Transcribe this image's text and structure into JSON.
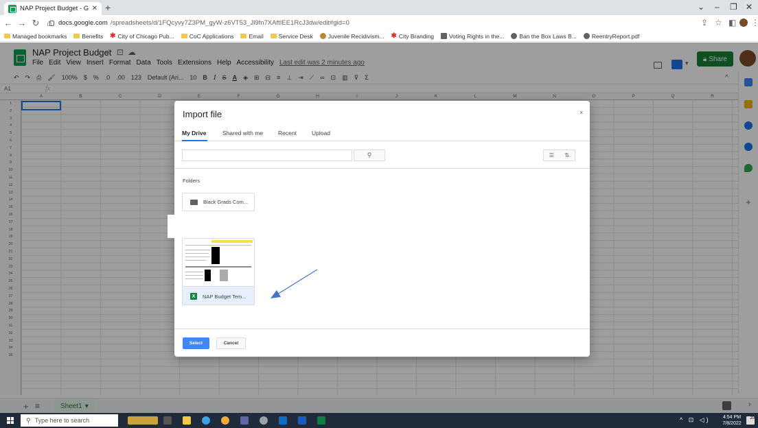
{
  "browser": {
    "tab_title": "NAP Project Budget - Google Sh",
    "url_host": "docs.google.com",
    "url_path": "/spreadsheets/d/1FQcyvy7Z3PM_gyW-z6VT53_Jl9fn7XAftIEE1RcJ3dw/edit#gid=0",
    "bookmarks": [
      {
        "icon": "folder",
        "label": "Managed bookmarks"
      },
      {
        "icon": "folder",
        "label": "Benefits"
      },
      {
        "icon": "star",
        "label": "City of Chicago Pub..."
      },
      {
        "icon": "folder",
        "label": "CoC Applications"
      },
      {
        "icon": "folder",
        "label": "Email"
      },
      {
        "icon": "folder",
        "label": "Service Desk"
      },
      {
        "icon": "globe",
        "label": "Juvenile Recidivism..."
      },
      {
        "icon": "star",
        "label": "City Branding"
      },
      {
        "icon": "globe",
        "label": "Voting Rights in the..."
      },
      {
        "icon": "globe",
        "label": "Ban the Box Laws B..."
      },
      {
        "icon": "globe",
        "label": "ReentryReport.pdf"
      }
    ]
  },
  "sheets": {
    "title": "NAP Project Budget",
    "menu": [
      "File",
      "Edit",
      "View",
      "Insert",
      "Format",
      "Data",
      "Tools",
      "Extensions",
      "Help",
      "Accessibility"
    ],
    "last_edit": "Last edit was 2 minutes ago",
    "share_label": "Share",
    "toolbar": {
      "zoom": "100%",
      "currency": "$",
      "percent": "%",
      "dec_less": ".0",
      "dec_more": ".00",
      "format_123": "123",
      "font": "Default (Ari...",
      "font_size": "10",
      "bold": "B",
      "italic": "I",
      "strike": "S",
      "text_color": "A"
    },
    "name_box": "A1",
    "fx": "fx",
    "columns": [
      "A",
      "B",
      "C",
      "D",
      "E",
      "F",
      "G",
      "H",
      "I",
      "J",
      "K",
      "L",
      "M",
      "N",
      "O",
      "P",
      "Q",
      "R"
    ],
    "rows": [
      "1",
      "2",
      "3",
      "4",
      "5",
      "6",
      "7",
      "8",
      "9",
      "10",
      "11",
      "12",
      "13",
      "14",
      "15",
      "16",
      "17",
      "18",
      "19",
      "20",
      "21",
      "22",
      "23",
      "24",
      "25",
      "26",
      "27",
      "28",
      "29",
      "30",
      "31",
      "32",
      "33",
      "34",
      "35"
    ],
    "sheet_tab": "Sheet1"
  },
  "dialog": {
    "title": "Import file",
    "close": "×",
    "tabs": [
      {
        "label": "My Drive",
        "active": true
      },
      {
        "label": "Shared with me",
        "active": false
      },
      {
        "label": "Recent",
        "active": false
      },
      {
        "label": "Upload",
        "active": false
      }
    ],
    "folders_label": "Folders",
    "folder_name": "Black Grads Com...",
    "file_name": "NAP Budget Tem...",
    "file_type_icon": "X",
    "select_label": "Select",
    "cancel_label": "Cancel"
  },
  "taskbar": {
    "search_placeholder": "Type here to search",
    "time": "4:54 PM",
    "date": "7/8/2022",
    "notif_count": "20"
  },
  "colors": {
    "sheets_green": "#0f9d58",
    "share_green": "#188038",
    "select_blue": "#4285f4",
    "accent_blue": "#1a73e8"
  }
}
